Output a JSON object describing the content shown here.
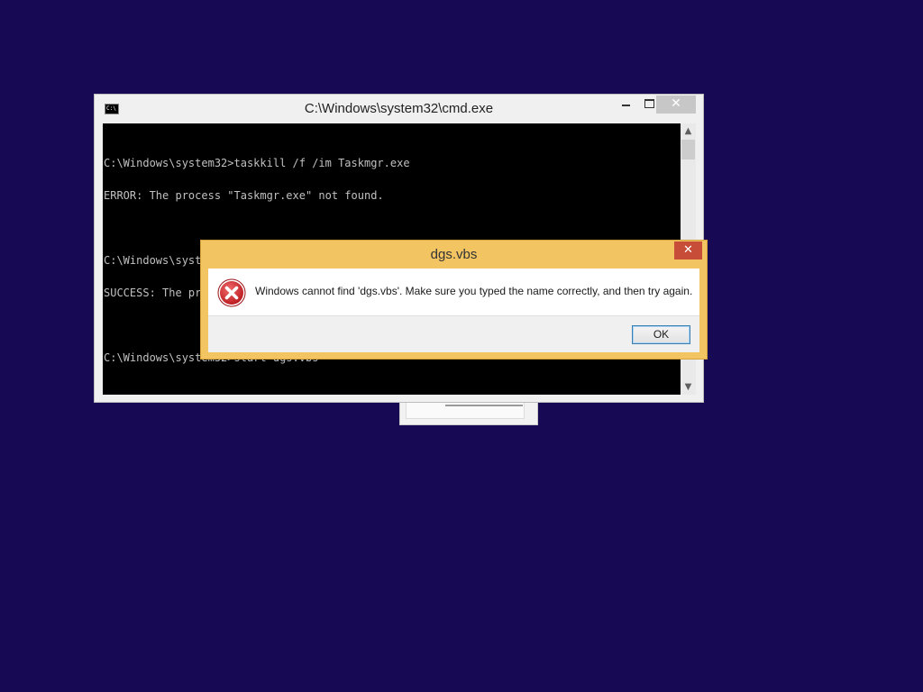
{
  "background_window": {},
  "cmd": {
    "title": "C:\\Windows\\system32\\cmd.exe",
    "icon_text": "C:\\",
    "lines": [
      "C:\\Windows\\system32>taskkill /f /im Taskmgr.exe",
      "ERROR: The process \"Taskmgr.exe\" not found.",
      "",
      "C:\\Windows\\system32>taskkill /f /im explorer.exe",
      "SUCCESS: The process \"explorer.exe\" with PID 2208 has been terminated.",
      "",
      "C:\\Windows\\system32>start dgs.vbs"
    ],
    "close_glyph": "✕",
    "scroll_up_glyph": "▲",
    "scroll_down_glyph": "▼"
  },
  "dialog": {
    "title": "dgs.vbs",
    "message": "Windows cannot find 'dgs.vbs'. Make sure you typed the name correctly, and then try again.",
    "ok_label": "OK",
    "close_glyph": "✕",
    "icon": "error-icon",
    "colors": {
      "frame": "#f2c462",
      "close": "#c74d38",
      "error_red": "#d8252b"
    }
  }
}
